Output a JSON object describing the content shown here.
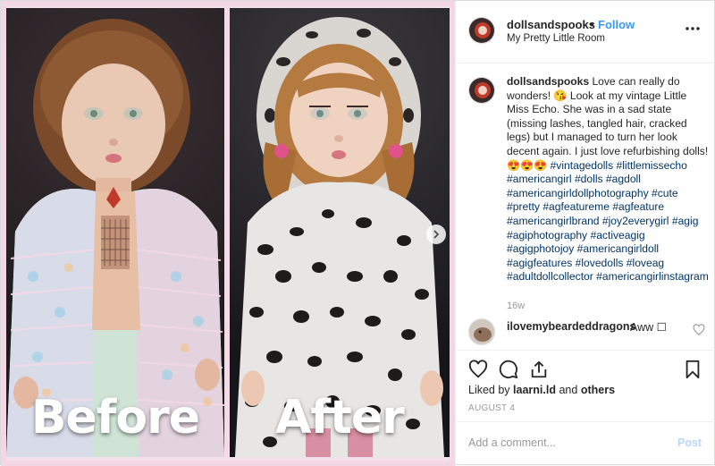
{
  "header": {
    "username": "dollsandspooks",
    "separator": "•",
    "follow_label": "Follow",
    "location": "My Pretty Little Room",
    "more_icon": "more-options-icon"
  },
  "media": {
    "before_label": "Before",
    "after_label": "After",
    "next_icon": "chevron-right-icon"
  },
  "caption": {
    "username": "dollsandspooks",
    "text_1": "Love can really do wonders! 😘  Look at my vintage Little Miss Echo. She was in a sad state (missing lashes, tangled hair, cracked legs) but I managed to turn her look decent again. I just love refurbishing dolls! 😍😍😍 ",
    "hashtags": "#vintagedolls #littlemissecho #americangirl #dolls #agdoll #americangirldollphotography #cute #pretty #agfeatureme #agfeature #americangirlbrand #joy2everygirl #agig #agiphotography #activeagig #agigphotojoy #americangirldoll #agigfeatures #lovedolls #loveag #adultdollcollector #americangirlinstagram",
    "time_ago": "16w"
  },
  "comment": {
    "username": "ilovemybeardeddragons",
    "text": "Aww ☐"
  },
  "actions": {
    "like_icon": "heart-icon",
    "comment_icon": "comment-icon",
    "share_icon": "share-icon",
    "save_icon": "bookmark-icon"
  },
  "likes": {
    "prefix": "Liked by",
    "user": "laarni.ld",
    "conjunction": "and",
    "others": "others"
  },
  "date": "AUGUST 4",
  "add_comment": {
    "placeholder": "Add a comment...",
    "post_label": "Post"
  },
  "colors": {
    "link_blue": "#3897f0",
    "hashtag": "#003569",
    "muted": "#999999",
    "border": "#dbdbdb",
    "frame_pink": "#f4d7e4"
  }
}
